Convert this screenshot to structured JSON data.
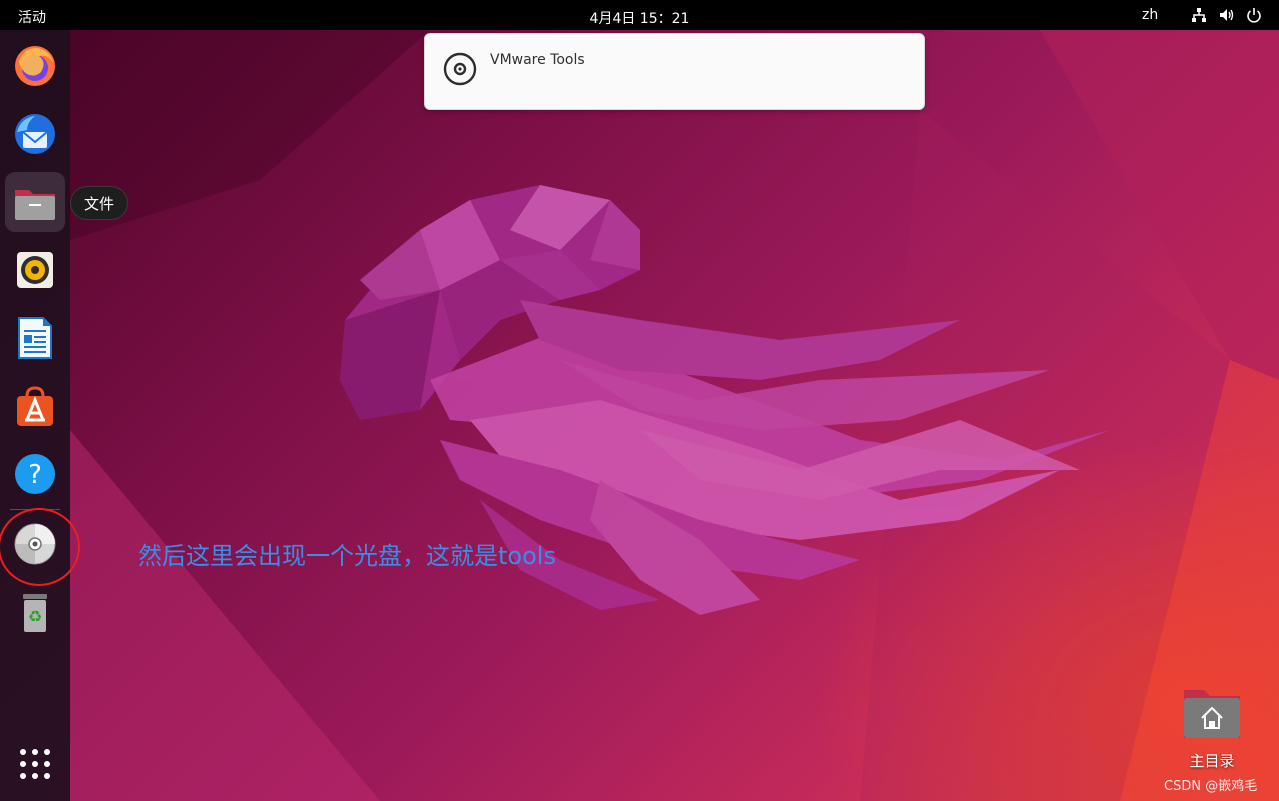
{
  "topbar": {
    "activities": "活动",
    "clock": "4月4日  15：21",
    "input_method": "zh",
    "tray_icons": [
      "network-icon",
      "volume-icon",
      "power-icon"
    ]
  },
  "dock": {
    "apps": [
      {
        "name": "firefox-icon",
        "running": false
      },
      {
        "name": "thunderbird-icon",
        "running": false
      },
      {
        "name": "files-icon",
        "running": false,
        "active": true
      },
      {
        "name": "rhythmbox-icon",
        "running": false
      },
      {
        "name": "libreoffice-writer-icon",
        "running": false
      },
      {
        "name": "app-center-icon",
        "running": false
      },
      {
        "name": "help-icon",
        "running": false
      },
      {
        "name": "optical-disc-icon",
        "running": false
      },
      {
        "name": "trash-icon",
        "running": false
      }
    ],
    "show_apps_icon": "app-grid-icon",
    "tooltip": "文件"
  },
  "notification": {
    "icon": "disc-icon",
    "title": "VMware Tools"
  },
  "annotation": "然后这里会出现一个光盘，这就是tools",
  "desktop": {
    "home_folder_label": "主目录",
    "home_folder_icon": "home-folder-icon"
  },
  "watermark": "CSDN @嵌鸡毛",
  "colors": {
    "annotation": "#3a8ee8",
    "highlight_circle": "#e82020",
    "topbar": "#000000"
  }
}
